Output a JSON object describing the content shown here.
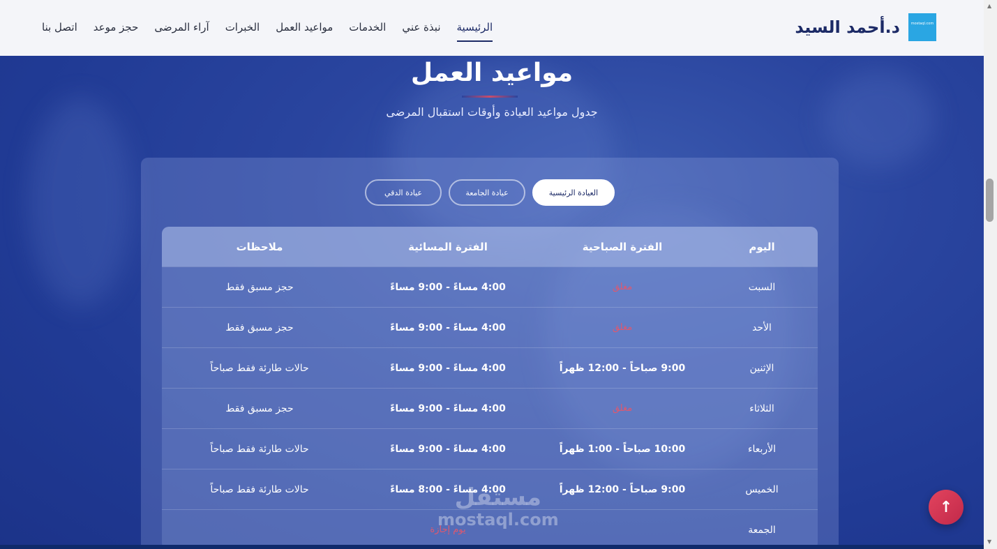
{
  "header": {
    "brand": "د.أحمد السيد",
    "logo_text": "mostaql.com",
    "nav": [
      {
        "label": "الرئيسية",
        "active": true
      },
      {
        "label": "نبذة عني",
        "active": false
      },
      {
        "label": "الخدمات",
        "active": false
      },
      {
        "label": "مواعيد العمل",
        "active": false
      },
      {
        "label": "الخبرات",
        "active": false
      },
      {
        "label": "آراء المرضى",
        "active": false
      },
      {
        "label": "حجز موعد",
        "active": false
      },
      {
        "label": "اتصل بنا",
        "active": false
      }
    ]
  },
  "section": {
    "title": "مواعيد العمل",
    "subtitle": "جدول مواعيد العيادة وأوقات استقبال المرضى"
  },
  "tabs": [
    "العيادة الرئيسية",
    "عيادة الجامعة",
    "عيادة الدقي"
  ],
  "table": {
    "headers": [
      "اليوم",
      "الفترة الصباحية",
      "الفترة المسائية",
      "ملاحظات"
    ],
    "rows": [
      {
        "day": "السبت",
        "morning": "مغلق",
        "evening": "4:00 مساءً - 9:00 مساءً",
        "notes": "حجز مسبق فقط"
      },
      {
        "day": "الأحد",
        "morning": "مغلق",
        "evening": "4:00 مساءً - 9:00 مساءً",
        "notes": "حجز مسبق فقط"
      },
      {
        "day": "الإثنين",
        "morning": "9:00 صباحاً - 12:00 ظهراً",
        "evening": "4:00 مساءً - 9:00 مساءً",
        "notes": "حالات طارئة فقط صباحاً"
      },
      {
        "day": "الثلاثاء",
        "morning": "مغلق",
        "evening": "4:00 مساءً - 9:00 مساءً",
        "notes": "حجز مسبق فقط"
      },
      {
        "day": "الأربعاء",
        "morning": "10:00 صباحاً - 1:00 ظهراً",
        "evening": "4:00 مساءً - 9:00 مساءً",
        "notes": "حالات طارئة فقط صباحاً"
      },
      {
        "day": "الخميس",
        "morning": "9:00 صباحاً - 12:00 ظهراً",
        "evening": "4:00 مساءً - 8:00 مساءً",
        "notes": "حالات طارئة فقط صباحاً"
      },
      {
        "day": "الجمعة",
        "morning": "",
        "evening": "يوم إجازة",
        "notes": ""
      }
    ]
  },
  "watermark": {
    "ar": "مستقل",
    "en": "mostaql.com"
  },
  "back_to_top_icon": "arrow-up-icon",
  "colors": {
    "primary": "#1c2a66",
    "accent": "#e2445e",
    "closed": "#e0586e"
  }
}
